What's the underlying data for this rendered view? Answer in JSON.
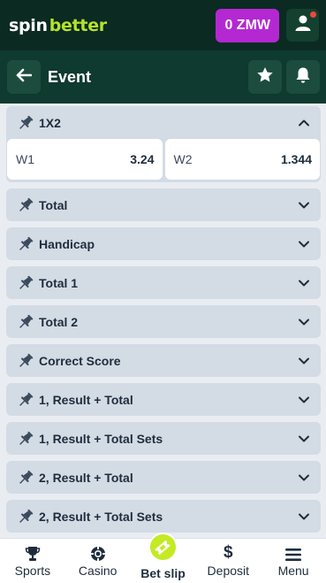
{
  "header": {
    "logo_part1": "spin",
    "logo_part2": "better",
    "balance": "0 ZMW",
    "user_icon": "user-icon"
  },
  "eventbar": {
    "title": "Event",
    "back_icon": "arrow-left-icon",
    "favorite_icon": "star-icon",
    "notify_icon": "bell-icon"
  },
  "markets": [
    {
      "title": "1X2",
      "expanded": true,
      "odds": [
        {
          "name": "W1",
          "value": "3.24"
        },
        {
          "name": "W2",
          "value": "1.344"
        }
      ]
    },
    {
      "title": "Total",
      "expanded": false
    },
    {
      "title": "Handicap",
      "expanded": false
    },
    {
      "title": "Total 1",
      "expanded": false
    },
    {
      "title": "Total 2",
      "expanded": false
    },
    {
      "title": "Correct Score",
      "expanded": false
    },
    {
      "title": "1, Result + Total",
      "expanded": false
    },
    {
      "title": "1, Result + Total Sets",
      "expanded": false
    },
    {
      "title": "2, Result + Total",
      "expanded": false
    },
    {
      "title": "2, Result + Total Sets",
      "expanded": false
    }
  ],
  "nav": {
    "sports": "Sports",
    "casino": "Casino",
    "betslip": "Bet slip",
    "deposit": "Deposit",
    "menu": "Menu"
  },
  "colors": {
    "header_bg": "#0a2a22",
    "eventbar_bg": "#0f3a2f",
    "accent_lime": "#b6e22c",
    "balance_purple": "#b428d2",
    "market_bg": "#d3dbe5"
  }
}
